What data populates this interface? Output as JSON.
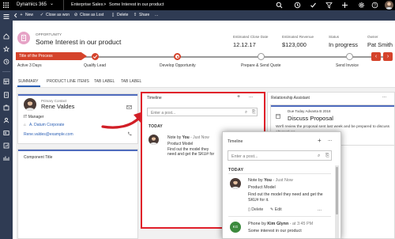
{
  "topnav": {
    "app_name": "Dynamics 365",
    "app_chevron": "⌄",
    "area": "Enterprise Sales",
    "breadcrumb_sep": ">",
    "record_crumb": "Some Interest in our product"
  },
  "commands": {
    "new": "New",
    "close_won": "Close as won",
    "close_lost": "Close as Lost",
    "delete": "Delete",
    "share": "Share",
    "more": "..."
  },
  "header": {
    "entity_type": "OPPORTUNITY",
    "title": "Some Interest in our product",
    "fields": [
      {
        "label": "Estimated Close Date",
        "value": "12.12.17"
      },
      {
        "label": "Estimated Revenue",
        "value": "$123,000"
      },
      {
        "label": "Status",
        "value": "In progress"
      },
      {
        "label": "Owner",
        "value": "Pat Smith"
      }
    ]
  },
  "bpf": {
    "title": "Title of the Process",
    "active_duration": "Active 3 Days",
    "stages": [
      {
        "label": "Qualify Lead",
        "state": "done"
      },
      {
        "label": "Develop Opportunity",
        "state": "active"
      },
      {
        "label": "Prepare & Send Quote",
        "state": "pending"
      },
      {
        "label": "Send Invoice",
        "state": "pending"
      }
    ],
    "prev": "‹",
    "next": "›"
  },
  "tabs": [
    "SUMMARY",
    "PRODUCT LINE ITEMS",
    "TAB LABEL",
    "TAB LABEL"
  ],
  "contact": {
    "label": "Primary Contact",
    "name": "Rene Valdes",
    "job_title": "IT Manager",
    "company": "A. Datum Corporate",
    "email": "Rene.valdes@example.com"
  },
  "component_title": "Component Title",
  "timeline": {
    "title": "Timeline",
    "add": "+",
    "more": "...",
    "post_placeholder": "Enter a post...",
    "today": "TODAY",
    "note_prefix": "Note by ",
    "note_author": "You",
    "note_time": " - Just Now",
    "note_subject": "Product Model",
    "note_body": "Find out the model they need and get the SKU# for it.",
    "delete_label": "Delete",
    "edit_label": "Edit",
    "phone_prefix": "Phone by ",
    "phone_author": "Kim Glynn",
    "phone_time": " - at 3:45 PM",
    "phone_subject": "Some interest in our product"
  },
  "relationship": {
    "title": "Relationship Assistant",
    "badge_prefix": "Due Today",
    "badge_source": "Advanta B 2018",
    "heading": "Discuss Proposal",
    "body": "We'll review the proposal sent last week and be prepared to discuss alternatives."
  },
  "colors": {
    "topbar": "#000000",
    "command_bar": "#2f3b53",
    "accent_red": "#d5432b",
    "tab_blue": "#2b5fb4",
    "highlight_red": "#e0202a"
  }
}
